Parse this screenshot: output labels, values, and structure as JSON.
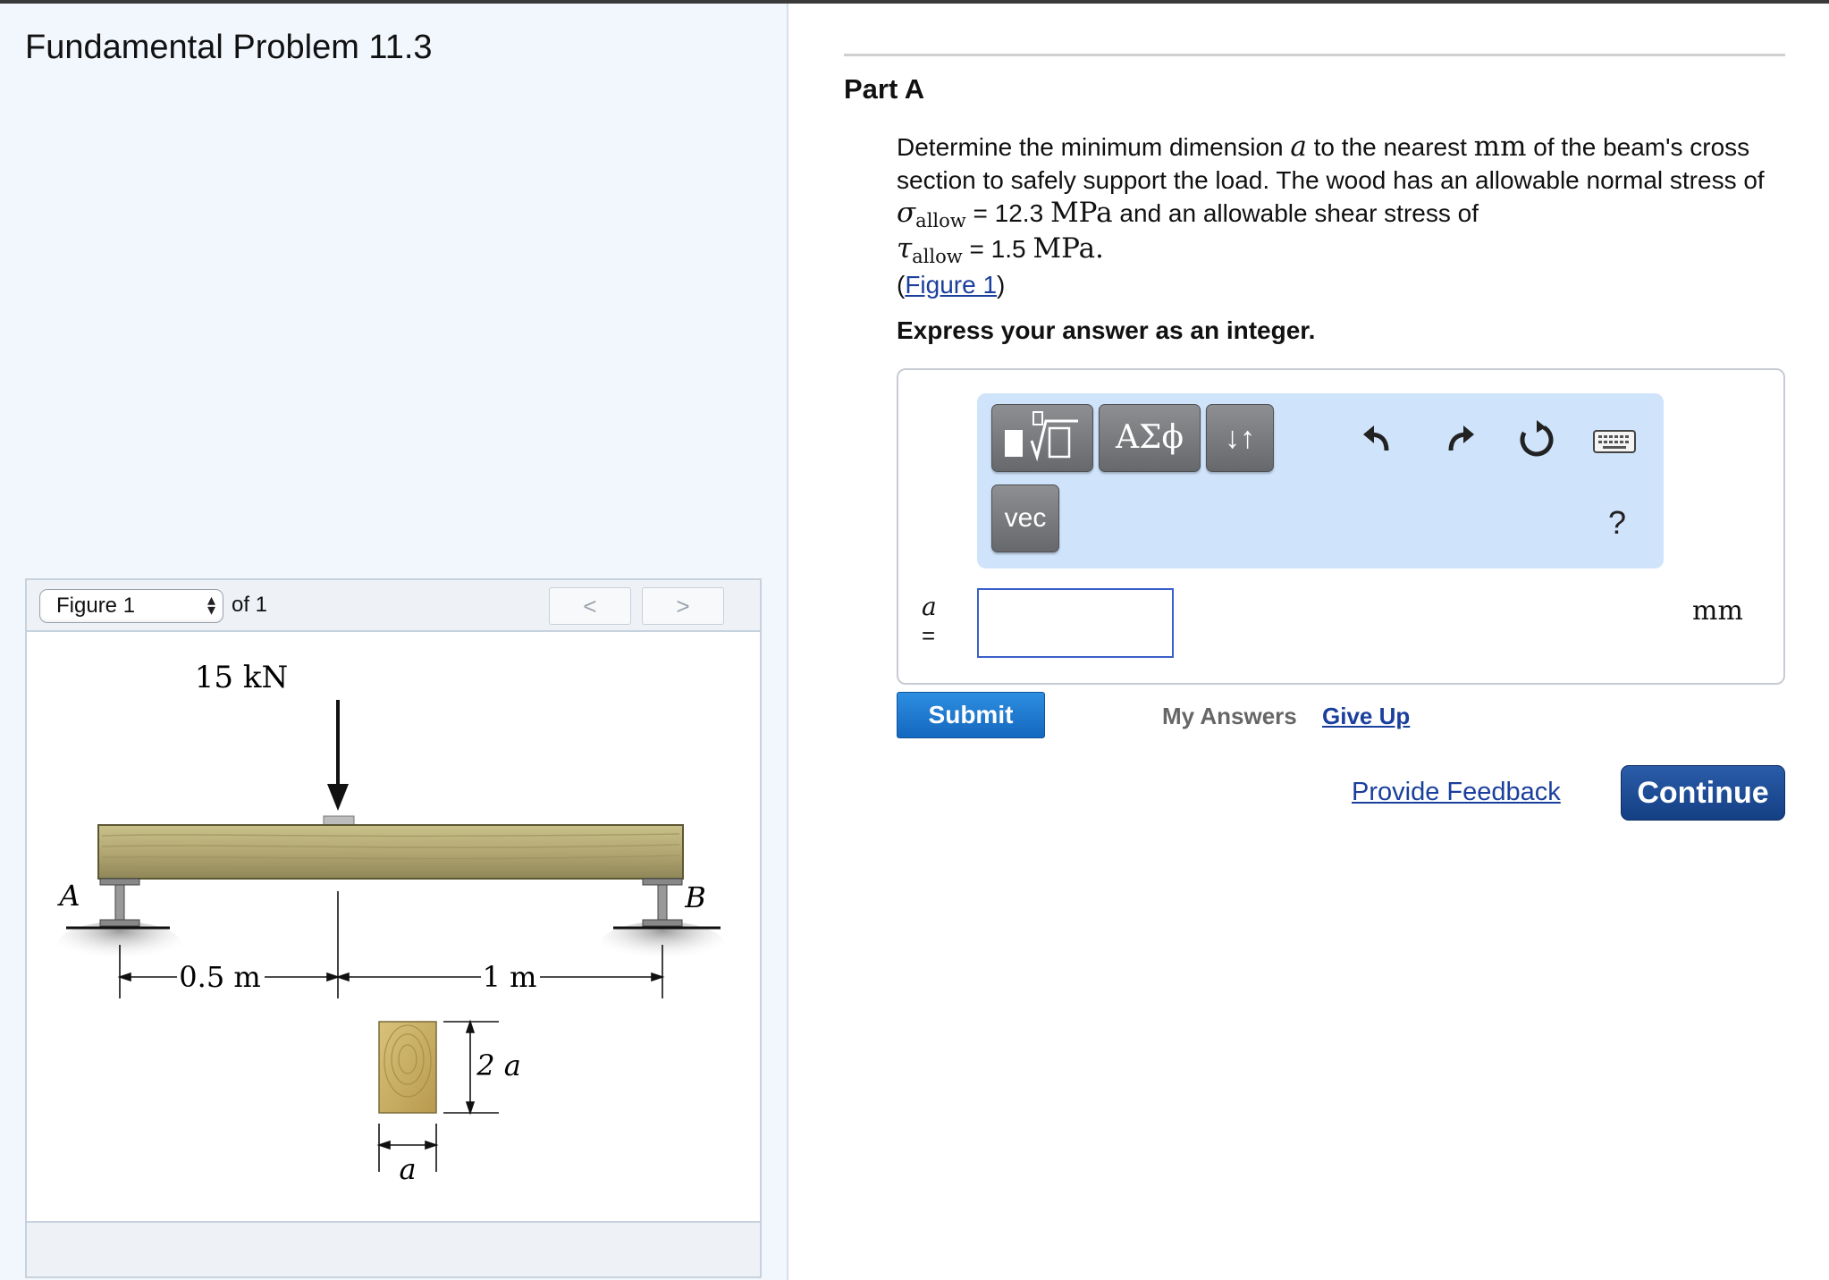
{
  "problem_title": "Fundamental Problem 11.3",
  "figure_nav": {
    "selected": "Figure 1",
    "of_label": "of 1",
    "prev_label": "<",
    "next_label": ">"
  },
  "figure": {
    "load_label": "15 kN",
    "support_a": "A",
    "support_b": "B",
    "dim_left": "0.5 m",
    "dim_right": "1 m",
    "height_label": "2 a",
    "width_label": "a"
  },
  "part": {
    "title": "Part A",
    "q_intro": "Determine the minimum dimension ",
    "q_var": "a",
    "q_mid1": " to the nearest ",
    "q_unit_mm": "mm",
    "q_mid2": " of the beam's cross section to safely support the load. The wood has an allowable normal stress of ",
    "sigma": "σ",
    "allow_sub": "allow",
    "sigma_value": " = 12.3 ",
    "unit_mpa": "MPa",
    "q_mid3": " and an allowable shear stress of ",
    "tau": "τ",
    "tau_value": " = 1.5 ",
    "unit_mpa_end": "MPa.",
    "figure_link": "Figure 1",
    "express": "Express your answer as an integer."
  },
  "toolbar": {
    "greek_label": "ΑΣϕ",
    "updown_label": "↓↑",
    "vec_label": "vec",
    "help_label": "?"
  },
  "answer": {
    "variable": "a",
    "equals": "=",
    "value": "",
    "unit": "mm"
  },
  "actions": {
    "submit": "Submit",
    "my_answers": "My Answers",
    "give_up": "Give Up",
    "provide_feedback": "Provide Feedback",
    "continue": "Continue"
  }
}
